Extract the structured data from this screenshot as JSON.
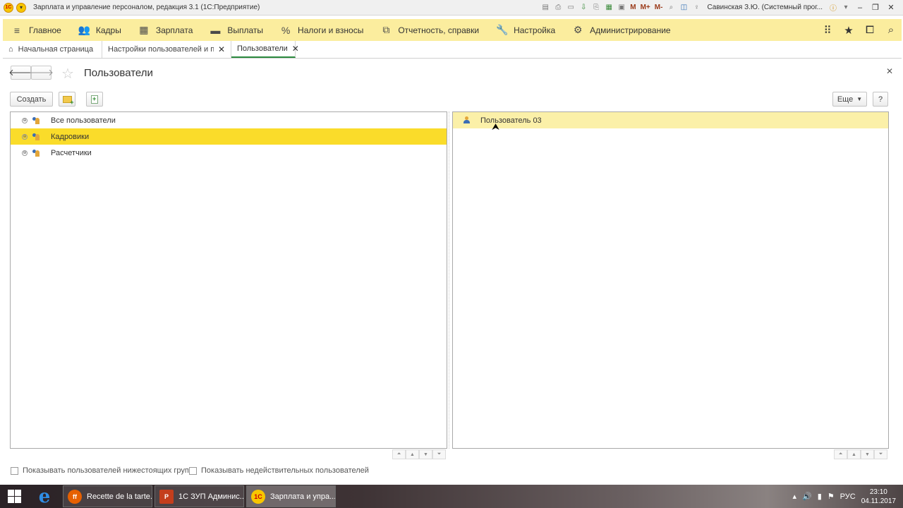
{
  "window": {
    "title": "Зарплата и управление персоналом, редакция 3.1  (1С:Предприятие)",
    "user": "Савинская З.Ю. (Системный прог..."
  },
  "titlebar_icons": [
    "save-icon",
    "print-icon",
    "preview-icon",
    "download-icon",
    "printer-icon",
    "table-icon",
    "calendar-icon",
    "m-label",
    "m-plus-label",
    "m-minus-label",
    "zoom-icon",
    "panel-icon",
    "bulb-icon"
  ],
  "titlebar_m": [
    "M",
    "M+",
    "M-"
  ],
  "main_menu": [
    {
      "label": "Главное",
      "icon": "menu-icon"
    },
    {
      "label": "Кадры",
      "icon": "people-icon"
    },
    {
      "label": "Зарплата",
      "icon": "calculator-icon"
    },
    {
      "label": "Выплаты",
      "icon": "wallet-icon"
    },
    {
      "label": "Налоги и взносы",
      "icon": "percent-icon"
    },
    {
      "label": "Отчетность, справки",
      "icon": "report-icon"
    },
    {
      "label": "Настройка",
      "icon": "wrench-icon"
    },
    {
      "label": "Администрирование",
      "icon": "gear-icon"
    }
  ],
  "tabs": [
    {
      "label": "Начальная страница"
    },
    {
      "label": "Настройки пользователей и прав"
    },
    {
      "label": "Пользователи"
    }
  ],
  "form": {
    "title": "Пользователи",
    "create_label": "Создать",
    "more_label": "Еще",
    "help_label": "?"
  },
  "groups": [
    {
      "label": "Все пользователи",
      "selected": false
    },
    {
      "label": "Кадровики",
      "selected": true
    },
    {
      "label": "Расчетчики",
      "selected": false
    }
  ],
  "users": [
    {
      "label": "Пользователь 03"
    }
  ],
  "options": {
    "show_subgroups": "Показывать пользователей нижестоящих групп",
    "show_invalid": "Показывать недействительных пользователей"
  },
  "taskbar": {
    "tasks": [
      {
        "label": "Recette de la tarte...",
        "icon": "firefox-icon"
      },
      {
        "label": "1С ЗУП Админис...",
        "icon": "powerpoint-icon"
      },
      {
        "label": "Зарплата и упра...",
        "icon": "1c-icon"
      }
    ],
    "lang": "РУС",
    "time": "23:10",
    "date": "04.11.2017"
  },
  "colors": {
    "menu_bg": "#fbed9e",
    "selection": "#fadc2a",
    "selection_light": "#fbf0a8",
    "active_tab": "#2b8a3e"
  }
}
